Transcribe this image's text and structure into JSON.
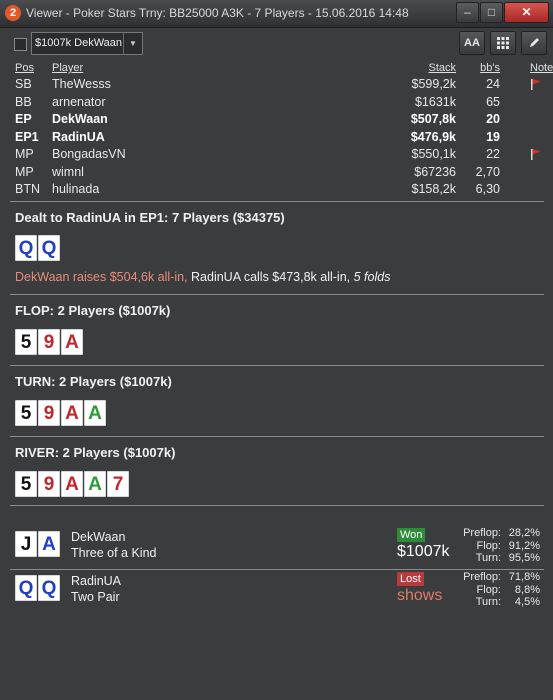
{
  "window": {
    "title": "Viewer - Poker Stars Trny: BB25000 A3K - 7 Players - 15.06.2016 14:48",
    "app_icon": "2",
    "min_label": "–",
    "max_label": "□",
    "close_label": "✕"
  },
  "toolbar": {
    "player_select_value": "$1007k DekWaan",
    "font_button": "AA",
    "grid_button": "⋯",
    "edit_button": "✎"
  },
  "table": {
    "headers": {
      "pos": "Pos",
      "player": "Player",
      "stack": "Stack",
      "bbs": "bb's",
      "notes": "Notes"
    },
    "rows": [
      {
        "pos": "SB",
        "player": "TheWesss",
        "stack": "$599,2k",
        "bbs": "24",
        "note_flag": true
      },
      {
        "pos": "BB",
        "player": "arnenator",
        "stack": "$1631k",
        "bbs": "65",
        "note_flag": false
      },
      {
        "pos": "EP",
        "player": "DekWaan",
        "stack": "$507,8k",
        "bbs": "20",
        "note_flag": false
      },
      {
        "pos": "EP1",
        "player": "RadinUA",
        "stack": "$476,9k",
        "bbs": "19",
        "note_flag": false
      },
      {
        "pos": "MP",
        "player": "BongadasVN",
        "stack": "$550,1k",
        "bbs": "22",
        "note_flag": true
      },
      {
        "pos": "MP",
        "player": "wimnl",
        "stack": "$67236",
        "bbs": "2,70",
        "note_flag": false
      },
      {
        "pos": "BTN",
        "player": "hulinada",
        "stack": "$158,2k",
        "bbs": "6,30",
        "note_flag": false
      }
    ]
  },
  "colors": {
    "red": "#c0282e",
    "blue": "#1f3fc4",
    "green": "#2e9a3c",
    "black": "#111111",
    "flag": "#d0322a"
  },
  "preflop": {
    "title": "Dealt to RadinUA in EP1: 7 Players ($34375)",
    "cards": [
      {
        "rank": "Q",
        "suit": "blue"
      },
      {
        "rank": "Q",
        "suit": "blue"
      }
    ],
    "action_raise": "DekWaan raises $504,6k all-in,",
    "action_call": " RadinUA calls $473,8k all-in, ",
    "action_folds": "5 folds"
  },
  "flop": {
    "title": "FLOP: 2 Players ($1007k)",
    "cards": [
      {
        "rank": "5",
        "suit": "black"
      },
      {
        "rank": "9",
        "suit": "red"
      },
      {
        "rank": "A",
        "suit": "red"
      }
    ]
  },
  "turn": {
    "title": "TURN: 2 Players ($1007k)",
    "cards": [
      {
        "rank": "5",
        "suit": "black"
      },
      {
        "rank": "9",
        "suit": "red"
      },
      {
        "rank": "A",
        "suit": "red"
      },
      {
        "rank": "A",
        "suit": "green"
      }
    ]
  },
  "river": {
    "title": "RIVER: 2 Players ($1007k)",
    "cards": [
      {
        "rank": "5",
        "suit": "black"
      },
      {
        "rank": "9",
        "suit": "red"
      },
      {
        "rank": "A",
        "suit": "red"
      },
      {
        "rank": "A",
        "suit": "green"
      },
      {
        "rank": "7",
        "suit": "red"
      }
    ]
  },
  "results": [
    {
      "player": "DekWaan",
      "hand": "Three of a Kind",
      "badge": "Won",
      "amount": "$1007k",
      "cards": [
        {
          "rank": "J",
          "suit": "black"
        },
        {
          "rank": "A",
          "suit": "blue"
        }
      ],
      "stats": [
        {
          "label": "Preflop:",
          "value": "28,2%"
        },
        {
          "label": "Flop:",
          "value": "91,2%"
        },
        {
          "label": "Turn:",
          "value": "95,5%"
        }
      ]
    },
    {
      "player": "RadinUA",
      "hand": "Two Pair",
      "badge": "Lost",
      "amount": "shows",
      "cards": [
        {
          "rank": "Q",
          "suit": "blue"
        },
        {
          "rank": "Q",
          "suit": "blue"
        }
      ],
      "stats": [
        {
          "label": "Preflop:",
          "value": "71,8%"
        },
        {
          "label": "Flop:",
          "value": "8,8%"
        },
        {
          "label": "Turn:",
          "value": "4,5%"
        }
      ]
    }
  ]
}
